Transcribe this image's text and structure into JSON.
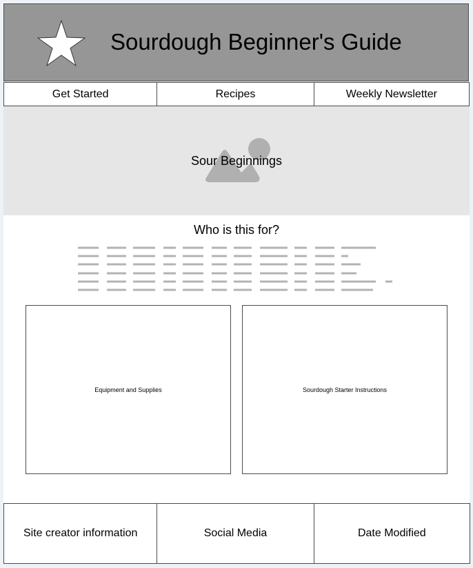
{
  "header": {
    "title": "Sourdough Beginner's Guide",
    "logo_icon": "star-icon",
    "background": "#969696"
  },
  "nav": {
    "items": [
      {
        "label": "Get Started"
      },
      {
        "label": "Recipes"
      },
      {
        "label": "Weekly Newsletter"
      }
    ]
  },
  "hero": {
    "caption": "Sour Beginnings",
    "image_icon": "image-placeholder-icon",
    "background": "#e6e6e6"
  },
  "intro": {
    "title": "Who is this for?"
  },
  "cards": [
    {
      "label": "Equipment and Supplies"
    },
    {
      "label": "Sourdough Starter Instructions"
    }
  ],
  "footer": {
    "items": [
      {
        "label": "Site creator information"
      },
      {
        "label": "Social Media"
      },
      {
        "label": "Date Modified"
      }
    ]
  }
}
